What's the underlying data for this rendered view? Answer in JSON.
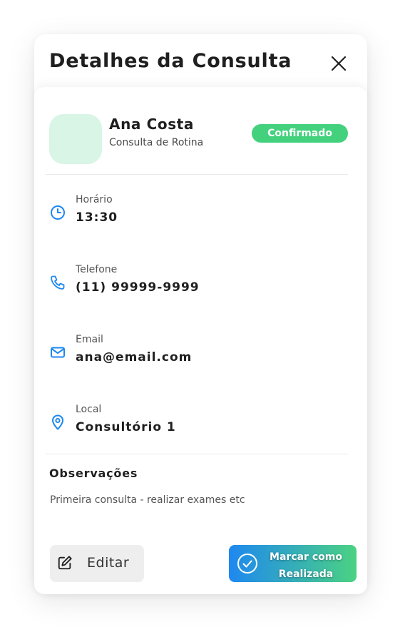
{
  "modal": {
    "title": "Detalhes da Consulta",
    "close_icon": "close-icon"
  },
  "patient": {
    "name": "Ana Costa",
    "type": "Consulta de Rotina",
    "status": "Confirmado",
    "status_color": "#44d17e",
    "avatar_color": "#d8f5e5"
  },
  "info": [
    {
      "icon": "clock-icon",
      "label": "Horário",
      "value": "13:30"
    },
    {
      "icon": "phone-icon",
      "label": "Telefone",
      "value": "(11) 99999-9999"
    },
    {
      "icon": "mail-icon",
      "label": "Email",
      "value": "ana@email.com"
    },
    {
      "icon": "location-pin-icon",
      "label": "Local",
      "value": "Consultório 1"
    }
  ],
  "notes": {
    "title": "Observações",
    "text": "Primeira consulta - realizar exames etc"
  },
  "actions": {
    "edit_label": "Editar",
    "edit_icon": "edit-icon",
    "done_label_line1": "Marcar como",
    "done_label_line2": "Realizada",
    "done_icon": "check-circle-icon",
    "accent_color": "#1e88f0",
    "gradient_end_color": "#4bd282"
  }
}
